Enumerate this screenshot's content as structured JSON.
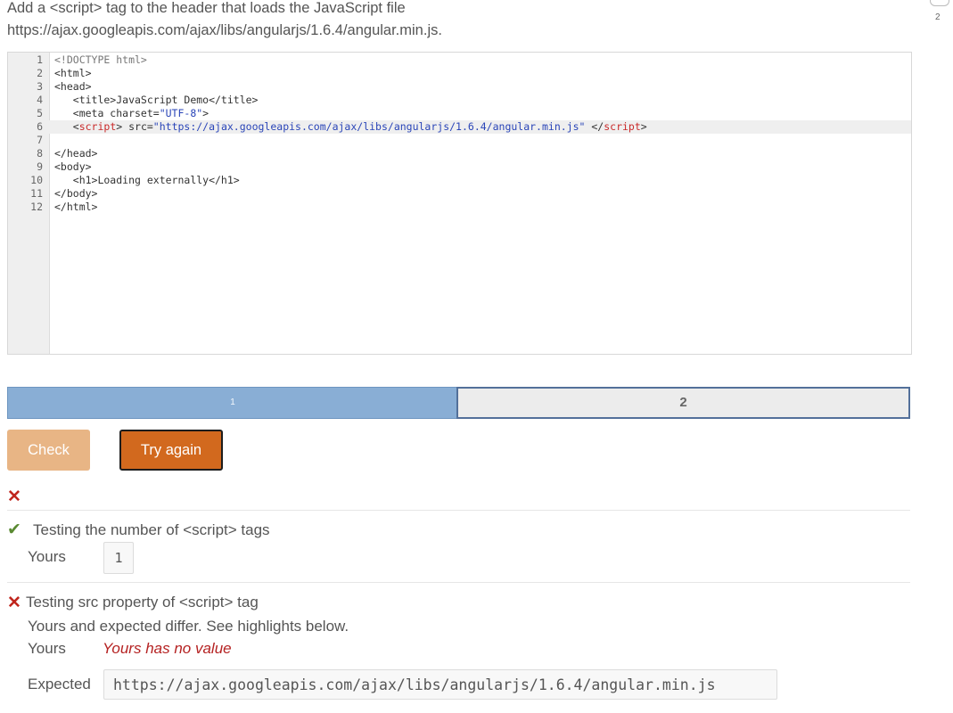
{
  "instructions": {
    "line1": "Add a <script> tag to the header that loads the JavaScript file",
    "line2": "https://ajax.googleapis.com/ajax/libs/angularjs/1.6.4/angular.min.js."
  },
  "corner": {
    "number": "2"
  },
  "editor": {
    "lines": [
      {
        "n": "1",
        "parts": [
          {
            "t": "<!DOCTYPE html>",
            "c": "doc"
          }
        ]
      },
      {
        "n": "2",
        "parts": [
          {
            "t": "<html>",
            "c": "tag"
          }
        ]
      },
      {
        "n": "3",
        "parts": [
          {
            "t": "<head>",
            "c": "tag"
          }
        ]
      },
      {
        "n": "4",
        "parts": [
          {
            "t": "   <title>JavaScript Demo</title>",
            "c": "tag"
          }
        ]
      },
      {
        "n": "5",
        "parts": [
          {
            "t": "   <meta charset=",
            "c": "tag"
          },
          {
            "t": "\"UTF-8\"",
            "c": "str"
          },
          {
            "t": ">",
            "c": "tag"
          }
        ]
      },
      {
        "n": "6",
        "active": true,
        "parts": [
          {
            "t": "   <",
            "c": "tag"
          },
          {
            "t": "script",
            "c": "err"
          },
          {
            "t": "> src=",
            "c": "tag"
          },
          {
            "t": "\"https://ajax.googleapis.com/ajax/libs/angularjs/1.6.4/angular.min.js\"",
            "c": "str"
          },
          {
            "t": " </",
            "c": "tag"
          },
          {
            "t": "script",
            "c": "err"
          },
          {
            "t": ">",
            "c": "tag"
          }
        ]
      },
      {
        "n": "7",
        "parts": [
          {
            "t": "",
            "c": "tag"
          }
        ]
      },
      {
        "n": "8",
        "parts": [
          {
            "t": "</head>",
            "c": "tag"
          }
        ]
      },
      {
        "n": "9",
        "parts": [
          {
            "t": "<body>",
            "c": "tag"
          }
        ]
      },
      {
        "n": "10",
        "parts": [
          {
            "t": "   <h1>Loading externally</h1>",
            "c": "tag"
          }
        ]
      },
      {
        "n": "11",
        "parts": [
          {
            "t": "</body>",
            "c": "tag"
          }
        ]
      },
      {
        "n": "12",
        "parts": [
          {
            "t": "</html>",
            "c": "tag"
          }
        ]
      }
    ]
  },
  "progress": {
    "step1": "1",
    "step2": "2"
  },
  "buttons": {
    "check": "Check",
    "try_again": "Try again"
  },
  "results": {
    "overall_mark": "✕",
    "test1": {
      "mark": "✔",
      "title": "Testing the number of <script> tags",
      "yours_label": "Yours",
      "yours_value": "1"
    },
    "test2": {
      "mark": "✕",
      "title": "Testing src property of <script> tag",
      "message": "Yours and expected differ. See highlights below.",
      "yours_label": "Yours",
      "yours_value": "Yours has no value",
      "expected_label": "Expected",
      "expected_value": "https://ajax.googleapis.com/ajax/libs/angularjs/1.6.4/angular.min.js"
    }
  }
}
